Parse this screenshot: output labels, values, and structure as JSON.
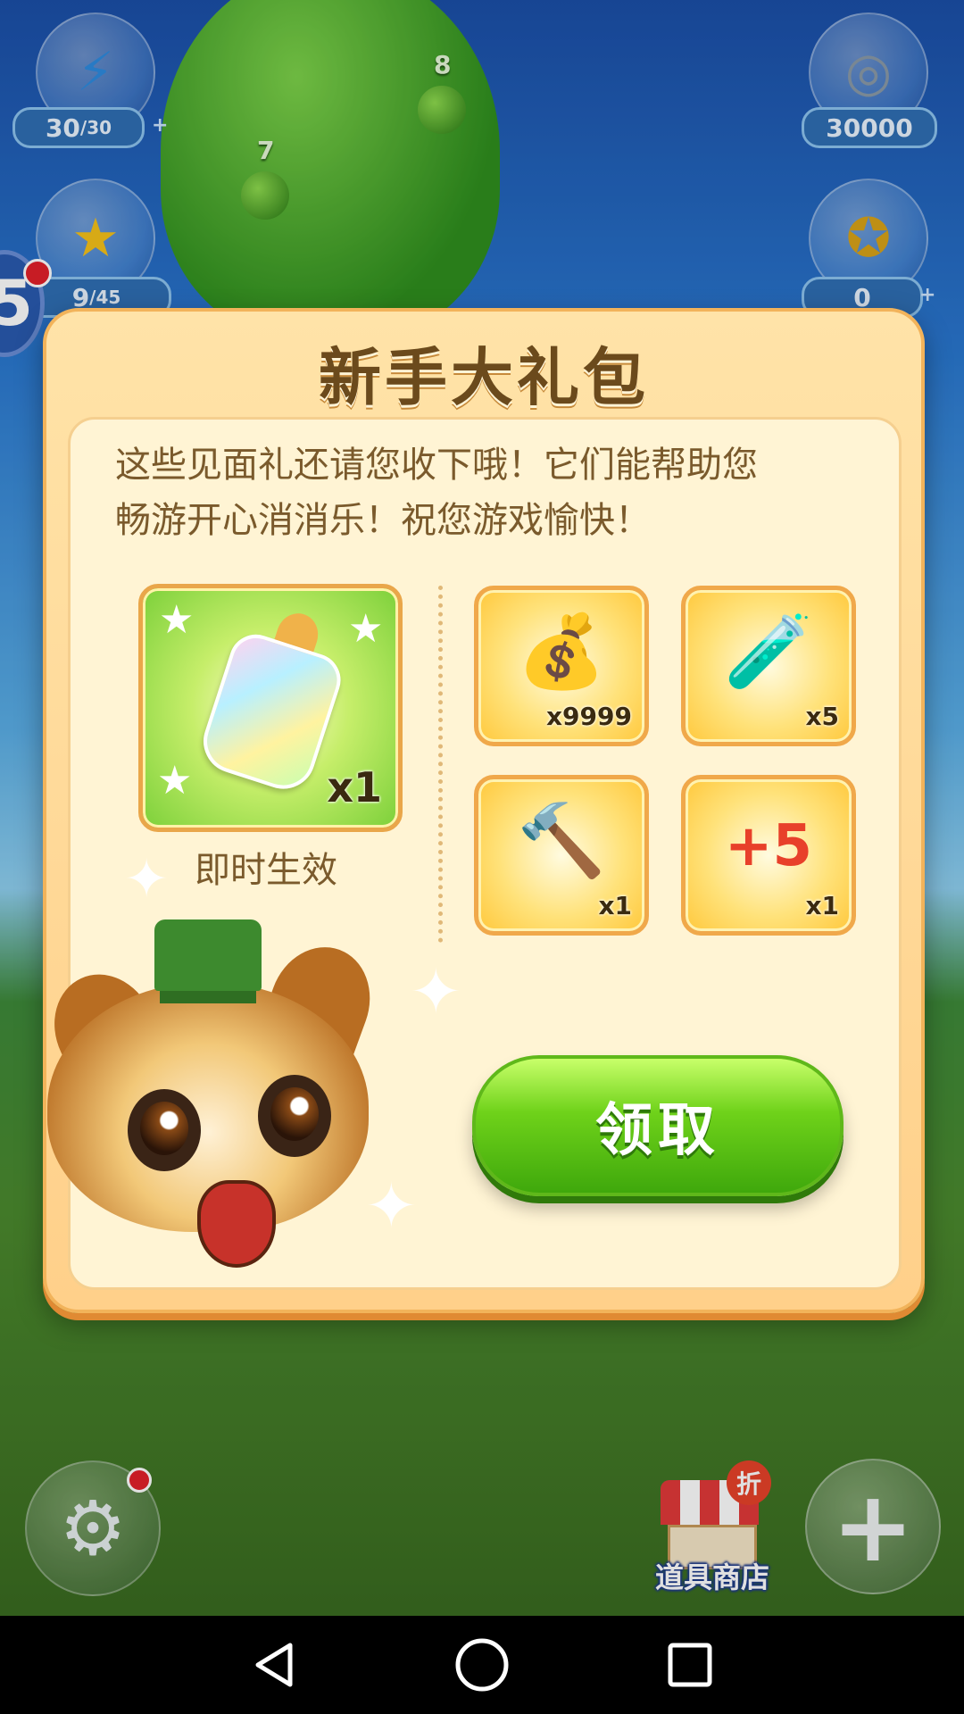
{
  "hud": {
    "energy": {
      "icon": "lightning-icon",
      "current": "30",
      "max": "/30"
    },
    "stars": {
      "icon": "star-icon",
      "current": "9",
      "max": "/45"
    },
    "coins": {
      "icon": "coin-icon",
      "value": "30000"
    },
    "gold": {
      "icon": "gold-coin-icon",
      "value": "0"
    }
  },
  "map": {
    "levels": [
      "7",
      "8"
    ],
    "left_badge": "5"
  },
  "dialog": {
    "title": "新手大礼包",
    "intro_line1": "这些见面礼还请您收下哦！它们能帮助您",
    "intro_line2": "畅游开心消消乐！祝您游戏愉快！",
    "featured": {
      "icon": "baby-bottle-icon",
      "quantity": "x1",
      "caption": "即时生效"
    },
    "items": [
      {
        "icon": "coin-sack-icon",
        "glyph": "💰",
        "quantity": "x9999"
      },
      {
        "icon": "energy-potion-icon",
        "glyph": "🧪",
        "quantity": "x5"
      },
      {
        "icon": "hammer-icon",
        "glyph": "🔨",
        "quantity": "x1"
      },
      {
        "icon": "plus-five-swap-icon",
        "glyph": "+5",
        "quantity": "x1"
      }
    ],
    "claim_label": "领取"
  },
  "bottom": {
    "settings_icon": "gear-icon",
    "shop_badge": "折",
    "shop_label": "道具商店",
    "plus_icon": "plus-icon"
  },
  "colors": {
    "claim_green": "#6fd21a",
    "dialog_bg": "#ffe3a8",
    "title_brown": "#6b4a1c"
  }
}
